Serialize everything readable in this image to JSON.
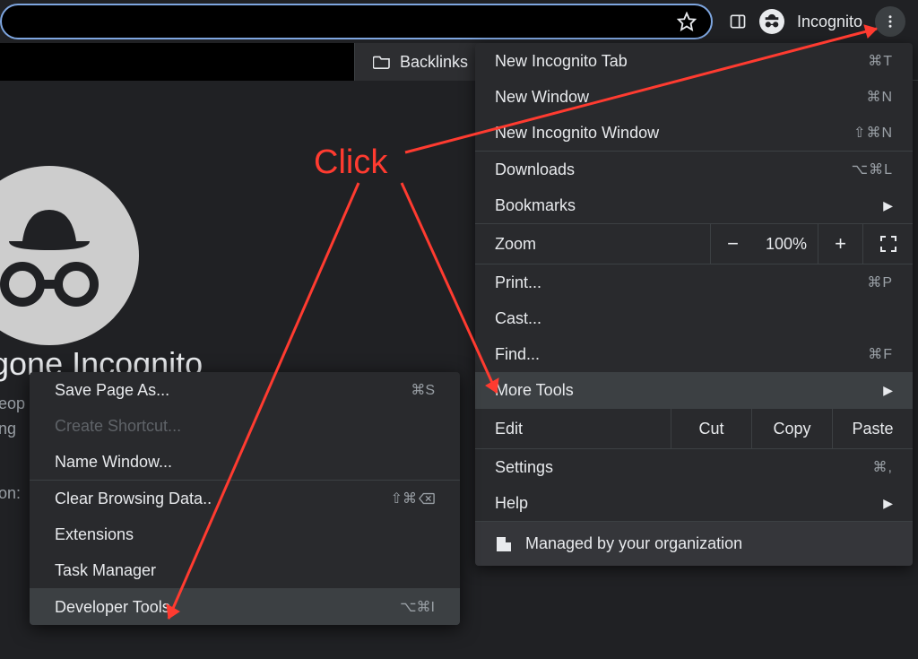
{
  "topbar": {
    "incognito_label": "Incognito"
  },
  "bookmarks": {
    "item1": "Backlinks"
  },
  "page": {
    "heading": "gone Incognito",
    "line1": "eop",
    "line2": "ng",
    "line3": "on:"
  },
  "menu": {
    "new_incog_tab": "New Incognito Tab",
    "new_incog_tab_sc": "⌘T",
    "new_window": "New Window",
    "new_window_sc": "⌘N",
    "new_incog_window": "New Incognito Window",
    "new_incog_window_sc": "⇧⌘N",
    "downloads": "Downloads",
    "downloads_sc": "⌥⌘L",
    "bookmarks": "Bookmarks",
    "zoom": "Zoom",
    "zoom_value": "100%",
    "print": "Print...",
    "print_sc": "⌘P",
    "cast": "Cast...",
    "find": "Find...",
    "find_sc": "⌘F",
    "more_tools": "More Tools",
    "edit": "Edit",
    "cut": "Cut",
    "copy": "Copy",
    "paste": "Paste",
    "settings": "Settings",
    "settings_sc": "⌘,",
    "help": "Help",
    "managed": "Managed by your organization"
  },
  "submenu": {
    "save_page": "Save Page As...",
    "save_page_sc": "⌘S",
    "create_shortcut": "Create Shortcut...",
    "name_window": "Name Window...",
    "clear_data": "Clear Browsing Data..",
    "clear_data_sc": "⇧⌘",
    "extensions": "Extensions",
    "task_manager": "Task Manager",
    "dev_tools": "Developer Tools",
    "dev_tools_sc": "⌥⌘I"
  },
  "annotation": {
    "click": "Click"
  }
}
